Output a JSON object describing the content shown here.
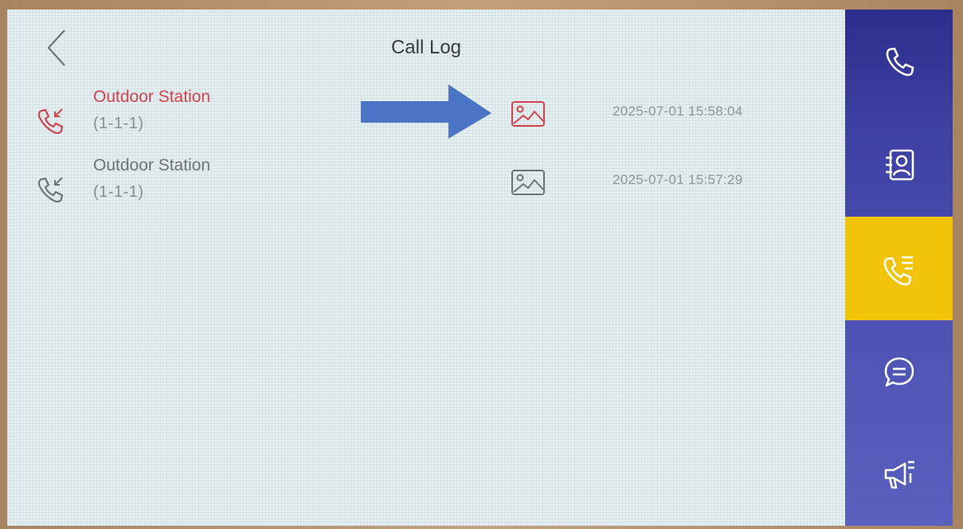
{
  "header": {
    "title": "Call Log"
  },
  "call_log": [
    {
      "name": "Outdoor Station",
      "room": "(1-1-1)",
      "time": "2025-07-01 15:58:04",
      "status": "missed"
    },
    {
      "name": "Outdoor Station",
      "room": "(1-1-1)",
      "time": "2025-07-01 15:57:29",
      "status": "normal"
    }
  ],
  "sidebar": {
    "items": [
      {
        "icon": "phone-icon",
        "active": false
      },
      {
        "icon": "contacts-icon",
        "active": false
      },
      {
        "icon": "call-log-icon",
        "active": true
      },
      {
        "icon": "message-icon",
        "active": false
      },
      {
        "icon": "megaphone-icon",
        "active": false
      }
    ]
  },
  "colors": {
    "missed": "#d2434e",
    "normal": "#6e7376",
    "sidebar": "#3d40a2",
    "active": "#f1c40a",
    "annotation_arrow": "#4a74c4"
  }
}
